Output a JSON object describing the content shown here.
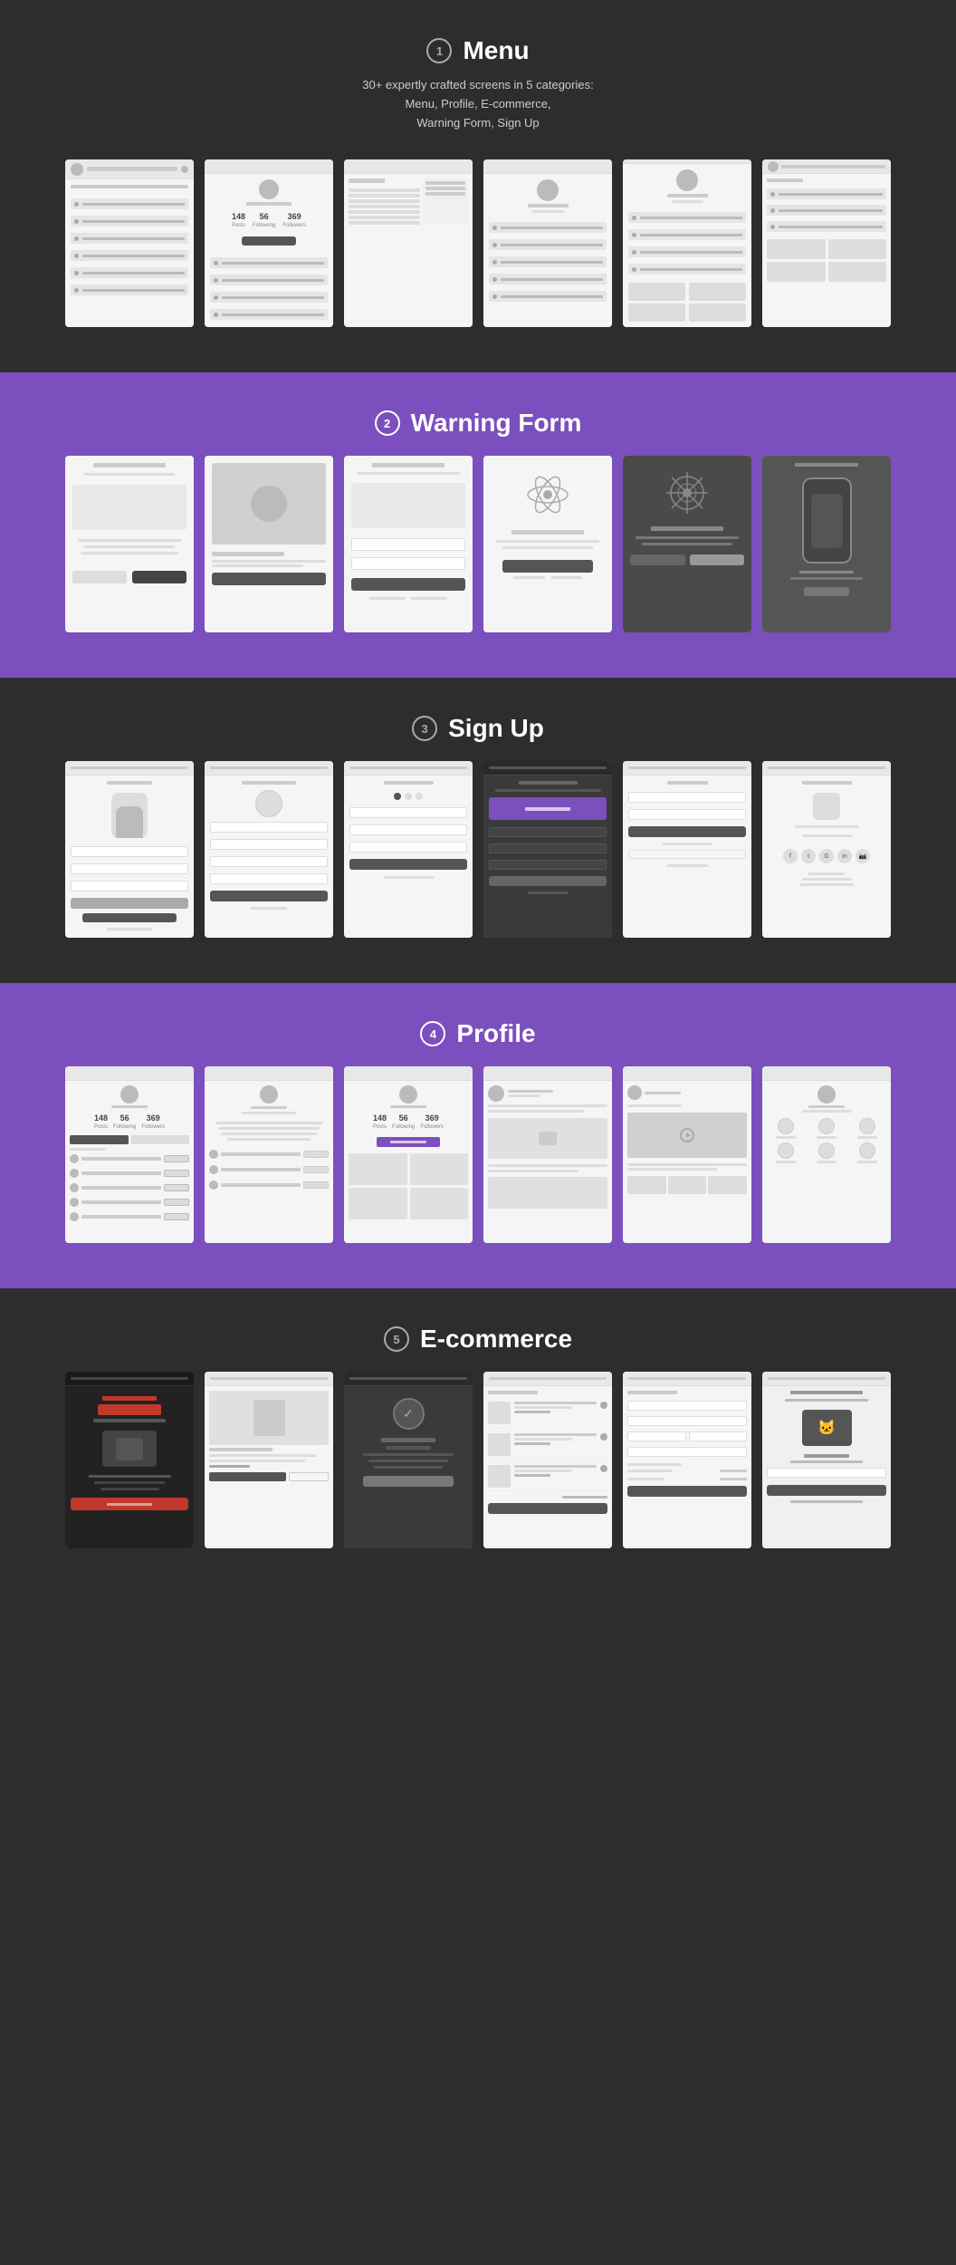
{
  "sections": [
    {
      "id": "menu",
      "number": "1",
      "title": "Menu",
      "subtitle": "30+ expertly crafted screens in 5 categories:\nMenu, Profile, E-commerce,\nWarning Form, Sign Up",
      "bg": "dark",
      "screens": [
        {
          "type": "menu_with_avatar",
          "id": "menu1"
        },
        {
          "type": "profile_stats",
          "id": "menu2"
        },
        {
          "type": "menu_contact",
          "id": "menu3"
        },
        {
          "type": "menu_avatar_center",
          "id": "menu4"
        },
        {
          "type": "menu_with_stats2",
          "id": "menu5"
        },
        {
          "type": "menu_grid",
          "id": "menu6"
        }
      ]
    },
    {
      "id": "warning",
      "number": "2",
      "title": "Warning Form",
      "bg": "purple",
      "screens": [
        {
          "type": "warning_welcome",
          "id": "warn1"
        },
        {
          "type": "warning_image",
          "id": "warn2"
        },
        {
          "type": "warning_form",
          "id": "warn3"
        },
        {
          "type": "warning_atom",
          "id": "warn4"
        },
        {
          "type": "warning_dark",
          "id": "warn5"
        },
        {
          "type": "warning_phone",
          "id": "warn6"
        }
      ]
    },
    {
      "id": "signup",
      "number": "3",
      "title": "Sign Up",
      "bg": "dark",
      "screens": [
        {
          "type": "signup_welcome",
          "id": "su1"
        },
        {
          "type": "signup_create",
          "id": "su2"
        },
        {
          "type": "signup_form",
          "id": "su3"
        },
        {
          "type": "signup_dark",
          "id": "su4"
        },
        {
          "type": "signup_login",
          "id": "su5"
        },
        {
          "type": "signup_social",
          "id": "su6"
        }
      ]
    },
    {
      "id": "profile",
      "number": "4",
      "title": "Profile",
      "bg": "purple",
      "screens": [
        {
          "type": "profile_list",
          "id": "pr1"
        },
        {
          "type": "profile_about",
          "id": "pr2"
        },
        {
          "type": "profile_following",
          "id": "pr3"
        },
        {
          "type": "profile_posts",
          "id": "pr4"
        },
        {
          "type": "profile_video",
          "id": "pr5"
        },
        {
          "type": "profile_icons",
          "id": "pr6"
        }
      ]
    },
    {
      "id": "ecommerce",
      "number": "5",
      "title": "E-commerce",
      "bg": "dark",
      "screens": [
        {
          "type": "ecom_sale",
          "id": "ec1"
        },
        {
          "type": "ecom_product",
          "id": "ec2"
        },
        {
          "type": "ecom_order_sent",
          "id": "ec3"
        },
        {
          "type": "ecom_cart",
          "id": "ec4"
        },
        {
          "type": "ecom_checkout",
          "id": "ec5"
        },
        {
          "type": "ecom_giftcard",
          "id": "ec6"
        }
      ]
    }
  ]
}
